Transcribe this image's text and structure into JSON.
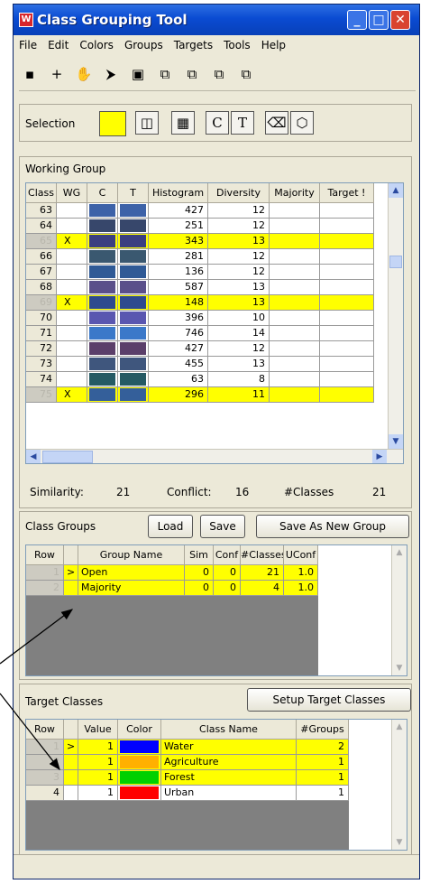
{
  "window": {
    "title": "Class Grouping Tool",
    "icon": "app-icon-W"
  },
  "menu": [
    "File",
    "Edit",
    "Colors",
    "Groups",
    "Targets",
    "Tools",
    "Help"
  ],
  "toolbar": [
    {
      "name": "save-icon",
      "glyph": "▪"
    },
    {
      "name": "crosshair-icon",
      "glyph": "+"
    },
    {
      "name": "pan-icon",
      "glyph": "✋"
    },
    {
      "name": "select-icon",
      "glyph": "⮞"
    },
    {
      "name": "color-icon",
      "glyph": "▣"
    },
    {
      "name": "copy-icon-1",
      "glyph": "⧉"
    },
    {
      "name": "copy-icon-2",
      "glyph": "⧉"
    },
    {
      "name": "copy-icon-3",
      "glyph": "⧉"
    },
    {
      "name": "copy-icon-4",
      "glyph": "⧉"
    }
  ],
  "selection": {
    "label": "Selection",
    "color": "#ffff00",
    "c_label": "C",
    "t_label": "T"
  },
  "working_group": {
    "title": "Working Group",
    "headers": [
      "Class",
      "WG",
      "C",
      "T",
      "Histogram",
      "Diversity",
      "Majority",
      "Target !"
    ],
    "rows": [
      {
        "cls": "63",
        "wg": "",
        "color": "#3d62a8",
        "hist": "427",
        "div": "12",
        "hl": false
      },
      {
        "cls": "64",
        "wg": "",
        "color": "#37476b",
        "hist": "251",
        "div": "12",
        "hl": false
      },
      {
        "cls": "65",
        "wg": "X",
        "color": "#3b3f80",
        "hist": "343",
        "div": "13",
        "hl": true
      },
      {
        "cls": "66",
        "wg": "",
        "color": "#3a5870",
        "hist": "281",
        "div": "12",
        "hl": false
      },
      {
        "cls": "67",
        "wg": "",
        "color": "#2f5a96",
        "hist": "136",
        "div": "12",
        "hl": false
      },
      {
        "cls": "68",
        "wg": "",
        "color": "#5a4f8a",
        "hist": "587",
        "div": "13",
        "hl": false
      },
      {
        "cls": "69",
        "wg": "X",
        "color": "#2e4a8e",
        "hist": "148",
        "div": "13",
        "hl": true
      },
      {
        "cls": "70",
        "wg": "",
        "color": "#5a56b0",
        "hist": "396",
        "div": "10",
        "hl": false
      },
      {
        "cls": "71",
        "wg": "",
        "color": "#3b78c9",
        "hist": "746",
        "div": "14",
        "hl": false
      },
      {
        "cls": "72",
        "wg": "",
        "color": "#5b3f6a",
        "hist": "427",
        "div": "12",
        "hl": false
      },
      {
        "cls": "73",
        "wg": "",
        "color": "#3f567d",
        "hist": "455",
        "div": "13",
        "hl": false
      },
      {
        "cls": "74",
        "wg": "",
        "color": "#255a64",
        "hist": "63",
        "div": "8",
        "hl": false
      },
      {
        "cls": "75",
        "wg": "X",
        "color": "#345f9a",
        "hist": "296",
        "div": "11",
        "hl": true
      }
    ]
  },
  "stats": {
    "similarity_label": "Similarity:",
    "similarity": "21",
    "conflict_label": "Conflict:",
    "conflict": "16",
    "classes_label": "#Classes",
    "classes": "21"
  },
  "class_groups": {
    "title": "Class Groups",
    "load": "Load",
    "save": "Save",
    "save_as": "Save As New Group",
    "headers": [
      "Row",
      "",
      "Group Name",
      "Sim",
      "Conf",
      "#Classes",
      "UConf"
    ],
    "rows": [
      {
        "row": "1",
        "mark": ">",
        "name": "Open",
        "sim": "0",
        "conf": "0",
        "classes": "21",
        "uconf": "1.0"
      },
      {
        "row": "2",
        "mark": "",
        "name": "Majority",
        "sim": "0",
        "conf": "0",
        "classes": "4",
        "uconf": "1.0"
      }
    ]
  },
  "target_classes": {
    "title": "Target Classes",
    "setup": "Setup Target Classes",
    "headers": [
      "Row",
      "",
      "Value",
      "Color",
      "Class Name",
      "#Groups"
    ],
    "rows": [
      {
        "row": "1",
        "mark": ">",
        "value": "1",
        "color": "#0000ff",
        "name": "Water",
        "groups": "2",
        "hl": true
      },
      {
        "row": "2",
        "mark": "",
        "value": "1",
        "color": "#ffb000",
        "name": "Agriculture",
        "groups": "1",
        "hl": true
      },
      {
        "row": "3",
        "mark": "",
        "value": "1",
        "color": "#00d000",
        "name": "Forest",
        "groups": "1",
        "hl": true
      },
      {
        "row": "4",
        "mark": "",
        "value": "1",
        "color": "#ff0000",
        "name": "Urban",
        "groups": "1",
        "hl": false
      }
    ]
  }
}
